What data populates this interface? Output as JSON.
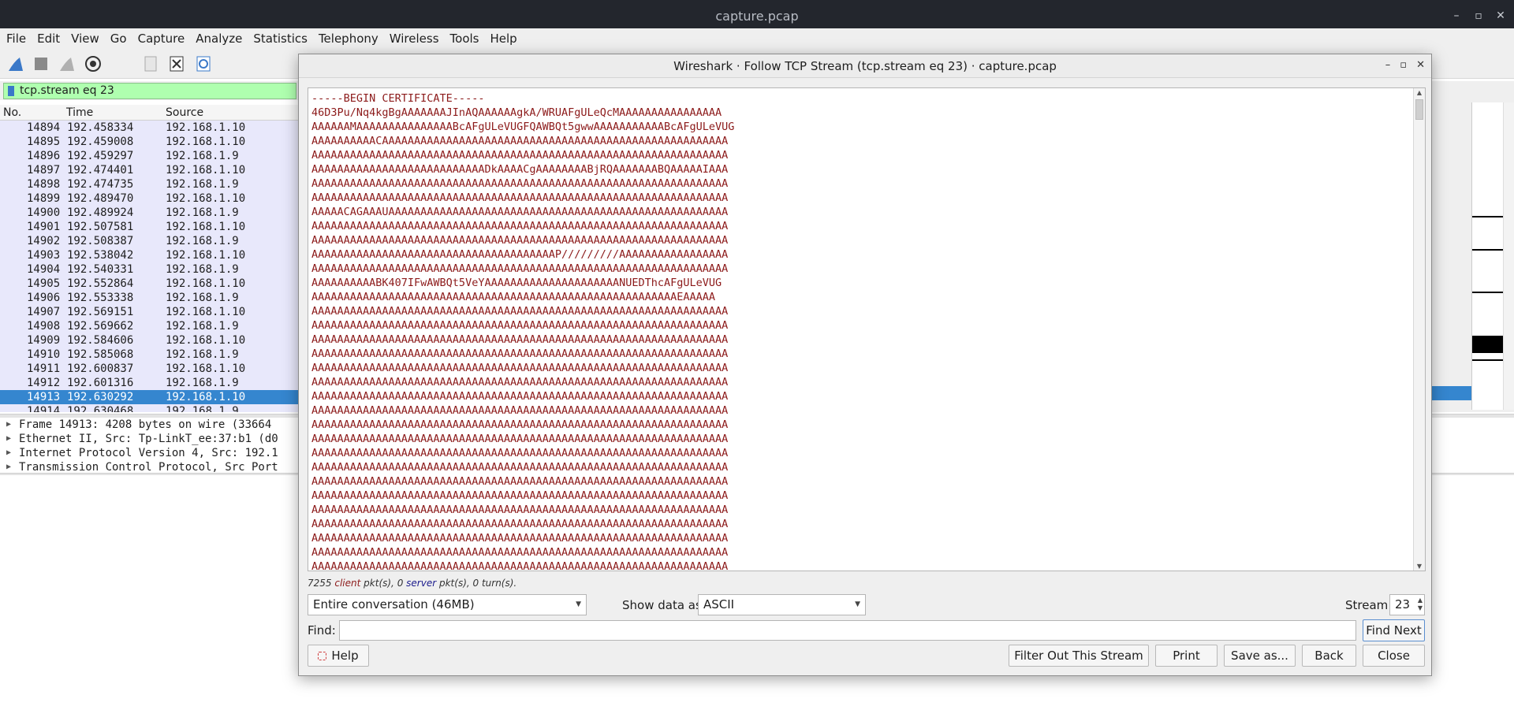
{
  "window": {
    "title": "capture.pcap",
    "controls": [
      "–",
      "▫",
      "✕"
    ]
  },
  "menu": [
    "File",
    "Edit",
    "View",
    "Go",
    "Capture",
    "Analyze",
    "Statistics",
    "Telephony",
    "Wireless",
    "Tools",
    "Help"
  ],
  "filter": {
    "value": "tcp.stream eq 23"
  },
  "columns": {
    "no": "No.",
    "time": "Time",
    "source": "Source"
  },
  "packets": [
    {
      "no": "14894",
      "time": "192.458334",
      "src": "192.168.1.10"
    },
    {
      "no": "14895",
      "time": "192.459008",
      "src": "192.168.1.10"
    },
    {
      "no": "14896",
      "time": "192.459297",
      "src": "192.168.1.9"
    },
    {
      "no": "14897",
      "time": "192.474401",
      "src": "192.168.1.10"
    },
    {
      "no": "14898",
      "time": "192.474735",
      "src": "192.168.1.9"
    },
    {
      "no": "14899",
      "time": "192.489470",
      "src": "192.168.1.10"
    },
    {
      "no": "14900",
      "time": "192.489924",
      "src": "192.168.1.9"
    },
    {
      "no": "14901",
      "time": "192.507581",
      "src": "192.168.1.10"
    },
    {
      "no": "14902",
      "time": "192.508387",
      "src": "192.168.1.9"
    },
    {
      "no": "14903",
      "time": "192.538042",
      "src": "192.168.1.10"
    },
    {
      "no": "14904",
      "time": "192.540331",
      "src": "192.168.1.9"
    },
    {
      "no": "14905",
      "time": "192.552864",
      "src": "192.168.1.10"
    },
    {
      "no": "14906",
      "time": "192.553338",
      "src": "192.168.1.9"
    },
    {
      "no": "14907",
      "time": "192.569151",
      "src": "192.168.1.10"
    },
    {
      "no": "14908",
      "time": "192.569662",
      "src": "192.168.1.9"
    },
    {
      "no": "14909",
      "time": "192.584606",
      "src": "192.168.1.10"
    },
    {
      "no": "14910",
      "time": "192.585068",
      "src": "192.168.1.9"
    },
    {
      "no": "14911",
      "time": "192.600837",
      "src": "192.168.1.10"
    },
    {
      "no": "14912",
      "time": "192.601316",
      "src": "192.168.1.9"
    },
    {
      "no": "14913",
      "time": "192.630292",
      "src": "192.168.1.10",
      "selected": true
    },
    {
      "no": "14914",
      "time": "192.630468",
      "src": "192.168.1.9"
    }
  ],
  "details": [
    "Frame 14913: 4208 bytes on wire (33664",
    "Ethernet II, Src: Tp-LinkT_ee:37:b1 (d0",
    "Internet Protocol Version 4, Src: 192.1",
    "Transmission Control Protocol, Src Port"
  ],
  "dialog": {
    "title": "Wireshark · Follow TCP Stream (tcp.stream eq 23) · capture.pcap",
    "controls": [
      "–",
      "▫",
      "✕"
    ],
    "stream_lines": [
      "-----BEGIN CERTIFICATE-----",
      "46D3Pu/Nq4kgBgAAAAAAAJInAQAAAAAAgkA/WRUAFgULeQcMAAAAAAAAAAAAAAAA",
      "AAAAAAMAAAAAAAAAAAAAAABcAFgULeVUGFQAWBQt5gwwAAAAAAAAAAABcAFgULeVUG",
      "AAAAAAAAAACAAAAAAAAAAAAAAAAAAAAAAAAAAAAAAAAAAAAAAAAAAAAAAAAAAAAAA",
      "AAAAAAAAAAAAAAAAAAAAAAAAAAAAAAAAAAAAAAAAAAAAAAAAAAAAAAAAAAAAAAAAA",
      "AAAAAAAAAAAAAAAAAAAAAAAAAAADkAAAACgAAAAAAAABjRQAAAAAAABQAAAAAIAAA",
      "AAAAAAAAAAAAAAAAAAAAAAAAAAAAAAAAAAAAAAAAAAAAAAAAAAAAAAAAAAAAAAAAA",
      "AAAAAAAAAAAAAAAAAAAAAAAAAAAAAAAAAAAAAAAAAAAAAAAAAAAAAAAAAAAAAAAAA",
      "AAAAACAGAAAUAAAAAAAAAAAAAAAAAAAAAAAAAAAAAAAAAAAAAAAAAAAAAAAAAAAAA",
      "AAAAAAAAAAAAAAAAAAAAAAAAAAAAAAAAAAAAAAAAAAAAAAAAAAAAAAAAAAAAAAAAA",
      "AAAAAAAAAAAAAAAAAAAAAAAAAAAAAAAAAAAAAAAAAAAAAAAAAAAAAAAAAAAAAAAAA",
      "AAAAAAAAAAAAAAAAAAAAAAAAAAAAAAAAAAAAAAP/////////AAAAAAAAAAAAAAAAA",
      "AAAAAAAAAAAAAAAAAAAAAAAAAAAAAAAAAAAAAAAAAAAAAAAAAAAAAAAAAAAAAAAAA",
      "AAAAAAAAAABK407IFwAWBQt5VeYAAAAAAAAAAAAAAAAAAAAANUEDThcAFgULeVUG",
      "AAAAAAAAAAAAAAAAAAAAAAAAAAAAAAAAAAAAAAAAAAAAAAAAAAAAAAAAAEAAAAA",
      "AAAAAAAAAAAAAAAAAAAAAAAAAAAAAAAAAAAAAAAAAAAAAAAAAAAAAAAAAAAAAAAAA",
      "AAAAAAAAAAAAAAAAAAAAAAAAAAAAAAAAAAAAAAAAAAAAAAAAAAAAAAAAAAAAAAAAA",
      "AAAAAAAAAAAAAAAAAAAAAAAAAAAAAAAAAAAAAAAAAAAAAAAAAAAAAAAAAAAAAAAAA",
      "AAAAAAAAAAAAAAAAAAAAAAAAAAAAAAAAAAAAAAAAAAAAAAAAAAAAAAAAAAAAAAAAA",
      "AAAAAAAAAAAAAAAAAAAAAAAAAAAAAAAAAAAAAAAAAAAAAAAAAAAAAAAAAAAAAAAAA",
      "AAAAAAAAAAAAAAAAAAAAAAAAAAAAAAAAAAAAAAAAAAAAAAAAAAAAAAAAAAAAAAAAA",
      "AAAAAAAAAAAAAAAAAAAAAAAAAAAAAAAAAAAAAAAAAAAAAAAAAAAAAAAAAAAAAAAAA",
      "AAAAAAAAAAAAAAAAAAAAAAAAAAAAAAAAAAAAAAAAAAAAAAAAAAAAAAAAAAAAAAAAA",
      "AAAAAAAAAAAAAAAAAAAAAAAAAAAAAAAAAAAAAAAAAAAAAAAAAAAAAAAAAAAAAAAAA",
      "AAAAAAAAAAAAAAAAAAAAAAAAAAAAAAAAAAAAAAAAAAAAAAAAAAAAAAAAAAAAAAAAA",
      "AAAAAAAAAAAAAAAAAAAAAAAAAAAAAAAAAAAAAAAAAAAAAAAAAAAAAAAAAAAAAAAAA",
      "AAAAAAAAAAAAAAAAAAAAAAAAAAAAAAAAAAAAAAAAAAAAAAAAAAAAAAAAAAAAAAAAA",
      "AAAAAAAAAAAAAAAAAAAAAAAAAAAAAAAAAAAAAAAAAAAAAAAAAAAAAAAAAAAAAAAAA",
      "AAAAAAAAAAAAAAAAAAAAAAAAAAAAAAAAAAAAAAAAAAAAAAAAAAAAAAAAAAAAAAAAA",
      "AAAAAAAAAAAAAAAAAAAAAAAAAAAAAAAAAAAAAAAAAAAAAAAAAAAAAAAAAAAAAAAAA",
      "AAAAAAAAAAAAAAAAAAAAAAAAAAAAAAAAAAAAAAAAAAAAAAAAAAAAAAAAAAAAAAAAA",
      "AAAAAAAAAAAAAAAAAAAAAAAAAAAAAAAAAAAAAAAAAAAAAAAAAAAAAAAAAAAAAAAAA",
      "AAAAAAAAAAAAAAAAAAAAAAAAAAAAAAAAAAAAAAAAAAAAAAAAAAAAAAAAAAAAAAAAA",
      "AAAAAAAAAAAAAAAAAAAAAAAAAAAAAAAAAAAAAAAAAAAAAAAAAAAAAAAAAAAAAAAAA"
    ],
    "status": {
      "count": "7255",
      "client": "client",
      "mid": "pkt(s), 0",
      "server": "server",
      "tail": "pkt(s), 0 turn(s)."
    },
    "conversation": "Entire conversation (46MB)",
    "show_data_label": "Show data as",
    "show_data_value": "ASCII",
    "stream_label": "Stream",
    "stream_value": "23",
    "find_label": "Find:",
    "find_value": "",
    "buttons": {
      "find_next": "Find Next",
      "help": "Help",
      "filter_out": "Filter Out This Stream",
      "print": "Print",
      "save_as": "Save as...",
      "back": "Back",
      "close": "Close"
    }
  },
  "colors": {
    "accent": "#3586cf",
    "filter_ok": "#afffaf",
    "client_text": "#8c1a1a",
    "server_text": "#1a1a8c"
  }
}
